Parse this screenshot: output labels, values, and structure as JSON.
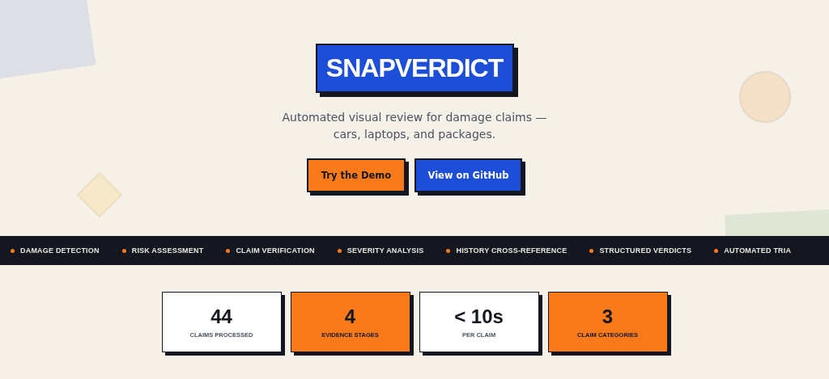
{
  "hero": {
    "logo": "SNAPVERDICT",
    "tagline": "Automated visual review for damage claims — cars, laptops, and packages.",
    "buttons": [
      {
        "label": "Try the Demo",
        "kind": "primary"
      },
      {
        "label": "View on GitHub",
        "kind": "secondary"
      }
    ]
  },
  "ticker": [
    "DAMAGE DETECTION",
    "RISK ASSESSMENT",
    "CLAIM VERIFICATION",
    "SEVERITY ANALYSIS",
    "HISTORY CROSS-REFERENCE",
    "STRUCTURED VERDICTS",
    "AUTOMATED TRIA"
  ],
  "stats": [
    {
      "value": "44",
      "label": "CLAIMS PROCESSED",
      "highlighted": false
    },
    {
      "value": "4",
      "label": "EVIDENCE STAGES",
      "highlighted": true
    },
    {
      "value": "< 10s",
      "label": "PER CLAIM",
      "highlighted": false
    },
    {
      "value": "3",
      "label": "CLAIM CATEGORIES",
      "highlighted": true
    }
  ]
}
